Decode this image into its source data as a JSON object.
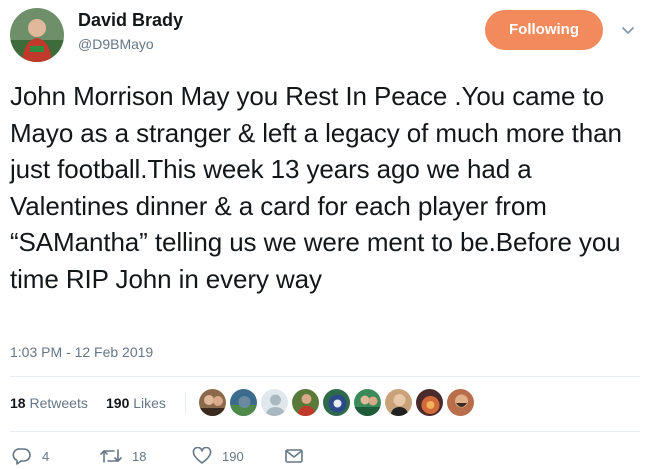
{
  "author": {
    "display_name": "David Brady",
    "handle": "@D9BMayo",
    "avatar_icon": "profile-photo-icon"
  },
  "follow_button": {
    "label": "Following",
    "color": "#f28a5c"
  },
  "tweet": {
    "text": "John Morrison May you Rest In Peace .You came to Mayo as a stranger & left a legacy of much more than just football.This week 13 years ago we had a Valentines dinner & a card for each player from “SAMantha” telling us we were ment to be.Before you time RIP John in every way",
    "timestamp": "1:03 PM - 12 Feb 2019"
  },
  "stats": {
    "retweets_count": "18",
    "retweets_label": "Retweets",
    "likes_count": "190",
    "likes_label": "Likes"
  },
  "likers": [
    {
      "name": "liker-avatar-1",
      "color": "#8a6a4a"
    },
    {
      "name": "liker-avatar-2",
      "color": "#3a6b8c"
    },
    {
      "name": "liker-avatar-3",
      "color": "#aab8c2"
    },
    {
      "name": "liker-avatar-4",
      "color": "#5a7a3a"
    },
    {
      "name": "liker-avatar-5",
      "color": "#2f6b4a"
    },
    {
      "name": "liker-avatar-6",
      "color": "#3a8a5a"
    },
    {
      "name": "liker-avatar-7",
      "color": "#c9a27a"
    },
    {
      "name": "liker-avatar-8",
      "color": "#d2693a"
    },
    {
      "name": "liker-avatar-9",
      "color": "#b86e4a"
    }
  ],
  "actions": {
    "reply_count": "4",
    "retweet_count": "18",
    "like_count": "190"
  }
}
